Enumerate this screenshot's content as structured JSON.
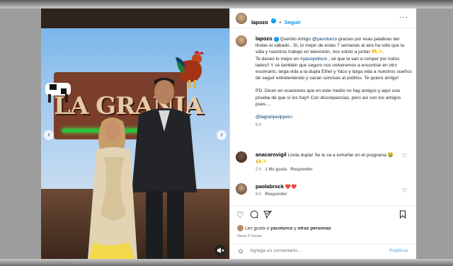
{
  "post": {
    "username": "lapozo",
    "follow_label": "Seguir",
    "more": "···"
  },
  "caption": {
    "username": "lapozo",
    "p1_a": "Querido Amigo ",
    "p1_mention": "@yacoturco",
    "p1_b": " gracias por esas palabras tan lindas el sábado . Sí, lo mejor de estas 7 semanas al aire ha sido que la vida y nuestros trabajo en televisión, nos volvió a juntar 🫶✨.",
    "p2_a": "Te deseo lo mejor en ",
    "p2_tag": "#yacoyelloco",
    "p2_b": " , sé que la van a romper por todos lados!! Y sé también que seguro nos volveremos a encontrar en otro escenario, larga vida a la dupla Ethel y Yaco y larga vida a nuestros sueños de seguir entreteniendo y sacan sonrisas al público. Te quiero amigo!",
    "p3": "PD: Dicen en ocasiones que en este medio no hay amigos y aquí una prueba de que sí los hay!! Con discrepancias, pero así son los amigos pues….",
    "p4_mention": "@lagranjavipperu",
    "time": "6 h"
  },
  "comments": [
    {
      "username": "anacarovigil",
      "text": "Linda dupla! Se le va a extrañar en el programa 😭🙌✨",
      "time": "2 h",
      "likes": "1 Me gusta",
      "reply": "Responder"
    },
    {
      "username": "paolabrock",
      "text": "❤️❤️",
      "time": "6 h",
      "reply": "Responder"
    }
  ],
  "likes": {
    "prefix": "Les gusta a ",
    "user": "yacoturco",
    "suffix": " y ",
    "others": "otras personas"
  },
  "post_time": "Hace 6 horas",
  "add_comment": {
    "placeholder": "Agrega un comentario...",
    "publish": "Publicar"
  },
  "photo": {
    "sign_text": "LA GRANJA"
  },
  "colors": {
    "accent": "#0095f6",
    "link": "#00376b",
    "muted": "#737373"
  },
  "icons": [
    "heart-icon",
    "comment-icon",
    "share-icon",
    "save-icon",
    "emoji-icon",
    "verified-icon",
    "more-icon",
    "mute-icon"
  ]
}
